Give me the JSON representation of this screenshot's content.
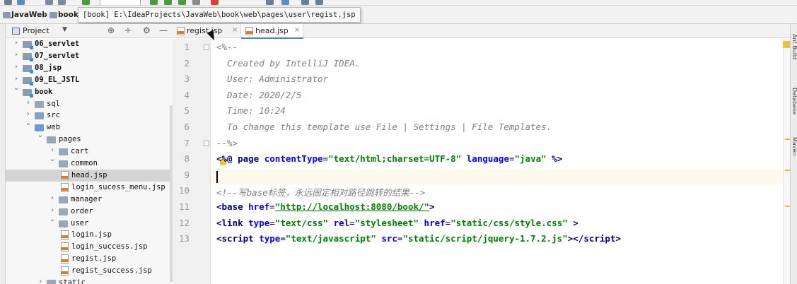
{
  "navbar": {
    "crumbs": [
      "JavaWeb",
      "book"
    ],
    "tooltip": "[book] E:\\IdeaProjects\\JavaWeb\\book\\web\\pages\\user\\regist.jsp"
  },
  "project_panel": {
    "title": "Project",
    "tree": [
      {
        "label": "06_servlet",
        "depth": 1,
        "kind": "module",
        "expanded": false,
        "bold": true
      },
      {
        "label": "07_servlet",
        "depth": 1,
        "kind": "module",
        "expanded": false,
        "bold": true
      },
      {
        "label": "08_jsp",
        "depth": 1,
        "kind": "module",
        "expanded": false,
        "bold": true
      },
      {
        "label": "09_EL_JSTL",
        "depth": 1,
        "kind": "module",
        "expanded": false,
        "bold": true
      },
      {
        "label": "book",
        "depth": 1,
        "kind": "module",
        "expanded": true,
        "bold": true
      },
      {
        "label": "sql",
        "depth": 2,
        "kind": "folder",
        "expanded": false
      },
      {
        "label": "src",
        "depth": 2,
        "kind": "src",
        "expanded": false
      },
      {
        "label": "web",
        "depth": 2,
        "kind": "web",
        "expanded": true
      },
      {
        "label": "pages",
        "depth": 3,
        "kind": "folder",
        "expanded": true
      },
      {
        "label": "cart",
        "depth": 4,
        "kind": "folder",
        "expanded": false
      },
      {
        "label": "common",
        "depth": 4,
        "kind": "folder",
        "expanded": true
      },
      {
        "label": "head.jsp",
        "depth": 5,
        "kind": "jsp",
        "selected": true
      },
      {
        "label": "login_sucess_menu.jsp",
        "depth": 5,
        "kind": "jsp"
      },
      {
        "label": "manager",
        "depth": 4,
        "kind": "folder",
        "expanded": false
      },
      {
        "label": "order",
        "depth": 4,
        "kind": "folder",
        "expanded": false
      },
      {
        "label": "user",
        "depth": 4,
        "kind": "folder",
        "expanded": true
      },
      {
        "label": "login.jsp",
        "depth": 5,
        "kind": "jsp"
      },
      {
        "label": "login_success.jsp",
        "depth": 5,
        "kind": "jsp"
      },
      {
        "label": "regist.jsp",
        "depth": 5,
        "kind": "jsp"
      },
      {
        "label": "regist_success.jsp",
        "depth": 5,
        "kind": "jsp"
      },
      {
        "label": "static",
        "depth": 3,
        "kind": "folder",
        "expanded": false
      }
    ]
  },
  "editor": {
    "tabs": [
      {
        "label": "regist.jsp",
        "active": false
      },
      {
        "label": "head.jsp",
        "active": true
      }
    ],
    "lines": [
      [
        {
          "t": "<%--",
          "c": "c-comment"
        }
      ],
      [
        {
          "t": "  Created by IntelliJ IDEA.",
          "c": "c-comment"
        }
      ],
      [
        {
          "t": "  User: Administrator",
          "c": "c-comment"
        }
      ],
      [
        {
          "t": "  Date: 2020/2/5",
          "c": "c-comment"
        }
      ],
      [
        {
          "t": "  Time: 10:24",
          "c": "c-comment"
        }
      ],
      [
        {
          "t": "  To change this template use File | Settings | File Templates.",
          "c": "c-comment"
        }
      ],
      [
        {
          "t": "--%>",
          "c": "c-comment"
        }
      ],
      [
        {
          "t": "<%@ ",
          "c": "c-tag"
        },
        {
          "t": "page ",
          "c": "c-tag"
        },
        {
          "t": "contentType",
          "c": "c-attr"
        },
        {
          "t": "=",
          "c": "c-plain"
        },
        {
          "t": "\"text/html;charset=UTF-8\"",
          "c": "c-str"
        },
        {
          "t": " ",
          "c": "c-plain"
        },
        {
          "t": "language",
          "c": "c-attr"
        },
        {
          "t": "=",
          "c": "c-plain"
        },
        {
          "t": "\"java\"",
          "c": "c-str"
        },
        {
          "t": " %>",
          "c": "c-tag"
        }
      ],
      [
        {
          "t": "",
          "c": "c-plain"
        }
      ],
      [
        {
          "t": "<!--写base标签，永远固定相对路径跳转的结果-->",
          "c": "c-comment"
        }
      ],
      [
        {
          "t": "<base ",
          "c": "c-tag"
        },
        {
          "t": "href",
          "c": "c-attr"
        },
        {
          "t": "=",
          "c": "c-plain"
        },
        {
          "t": "\"http://localhost:8080/book/\"",
          "c": "c-str-u"
        },
        {
          "t": ">",
          "c": "c-tag"
        }
      ],
      [
        {
          "t": "<link ",
          "c": "c-tag"
        },
        {
          "t": "type",
          "c": "c-attr"
        },
        {
          "t": "=",
          "c": "c-plain"
        },
        {
          "t": "\"text/css\"",
          "c": "c-str"
        },
        {
          "t": " ",
          "c": "c-plain"
        },
        {
          "t": "rel",
          "c": "c-attr"
        },
        {
          "t": "=",
          "c": "c-plain"
        },
        {
          "t": "\"stylesheet\"",
          "c": "c-str"
        },
        {
          "t": " ",
          "c": "c-plain"
        },
        {
          "t": "href",
          "c": "c-attr"
        },
        {
          "t": "=",
          "c": "c-plain"
        },
        {
          "t": "\"static/css/style.css\"",
          "c": "c-str"
        },
        {
          "t": " >",
          "c": "c-tag"
        }
      ],
      [
        {
          "t": "<script ",
          "c": "c-tag"
        },
        {
          "t": "type",
          "c": "c-attr"
        },
        {
          "t": "=",
          "c": "c-plain"
        },
        {
          "t": "\"text/javascript\"",
          "c": "c-str"
        },
        {
          "t": " ",
          "c": "c-plain"
        },
        {
          "t": "src",
          "c": "c-attr"
        },
        {
          "t": "=",
          "c": "c-plain"
        },
        {
          "t": "\"static/script/jquery-1.7.2.js\"",
          "c": "c-str"
        },
        {
          "t": "></",
          "c": "c-tag"
        },
        {
          "t": "script",
          "c": "c-tag"
        },
        {
          "t": ">",
          "c": "c-tag"
        }
      ]
    ]
  },
  "right_strip": {
    "labels": [
      "Ant Build",
      "Database",
      "Maven"
    ]
  }
}
